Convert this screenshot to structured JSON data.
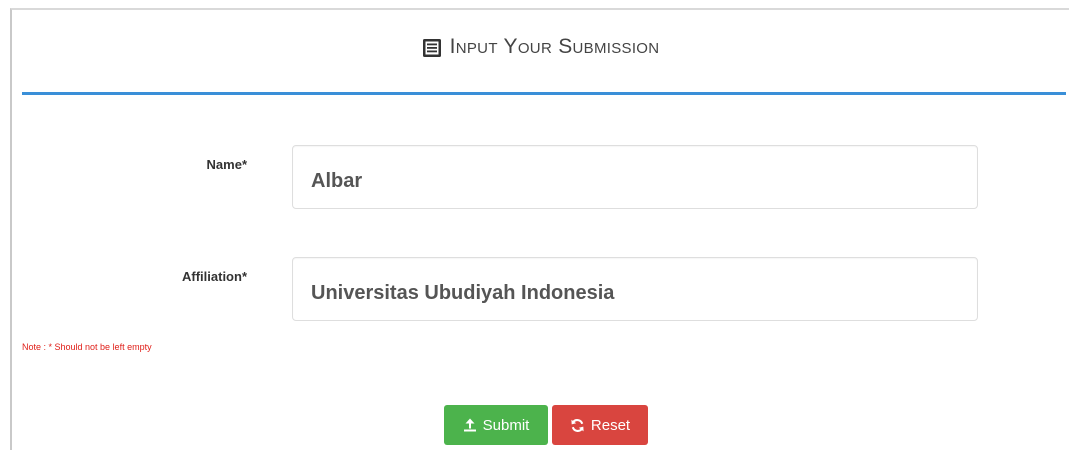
{
  "panel": {
    "title": "Input Your Submission",
    "icon": "list-icon"
  },
  "form": {
    "name": {
      "label": "Name",
      "required_mark": "*",
      "value": "Albar"
    },
    "affiliation": {
      "label": "Affiliation",
      "required_mark": "*",
      "value": "Universitas Ubudiyah Indonesia"
    },
    "note": "Note : * Should not be left empty"
  },
  "buttons": {
    "submit": {
      "label": "Submit",
      "icon": "upload-icon",
      "color": "#4cb34c"
    },
    "reset": {
      "label": "Reset",
      "icon": "refresh-icon",
      "color": "#d9453f"
    }
  },
  "colors": {
    "accent_rule": "#3a8fd8",
    "note_text": "#e0201a"
  }
}
